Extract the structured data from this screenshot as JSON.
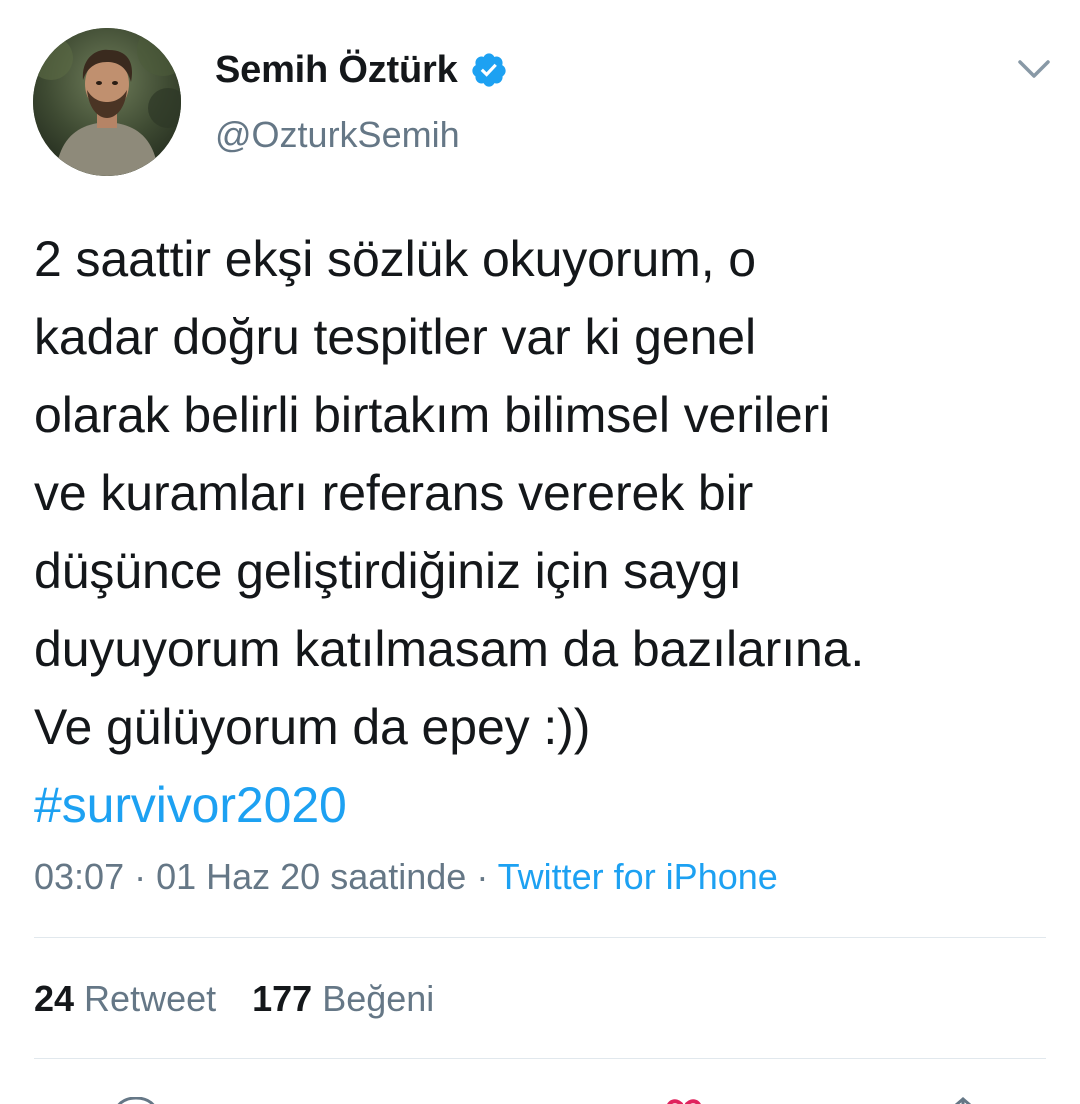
{
  "user": {
    "display_name": "Semih Öztürk",
    "handle": "@OzturkSemih",
    "verified": true,
    "avatar_icon": "profile-photo"
  },
  "tweet": {
    "lines": [
      "2 saattir ekşi sözlük okuyorum, o",
      "kadar doğru tespitler var ki genel",
      "olarak belirli birtakım bilimsel verileri",
      "ve kuramları referans vererek bir",
      "düşünce geliştirdiğiniz için saygı",
      "duyuyorum katılmasam da bazılarına.",
      "Ve gülüyorum da epey :))"
    ],
    "hashtag": "#survivor2020"
  },
  "meta": {
    "timestamp": "03:07 · 01 Haz 20 saatinde",
    "separator": " · ",
    "source": "Twitter for iPhone"
  },
  "stats": {
    "retweets_count": "24",
    "retweets_label": "Retweet",
    "likes_count": "177",
    "likes_label": "Beğeni"
  },
  "colors": {
    "accent": "#1da1f2",
    "secondary_text": "#657786",
    "primary_text": "#14171a",
    "divider": "#e1e8ed",
    "like_red": "#e0245e"
  },
  "icons": {
    "verified": "verified-badge-icon",
    "menu": "chevron-down-icon"
  }
}
